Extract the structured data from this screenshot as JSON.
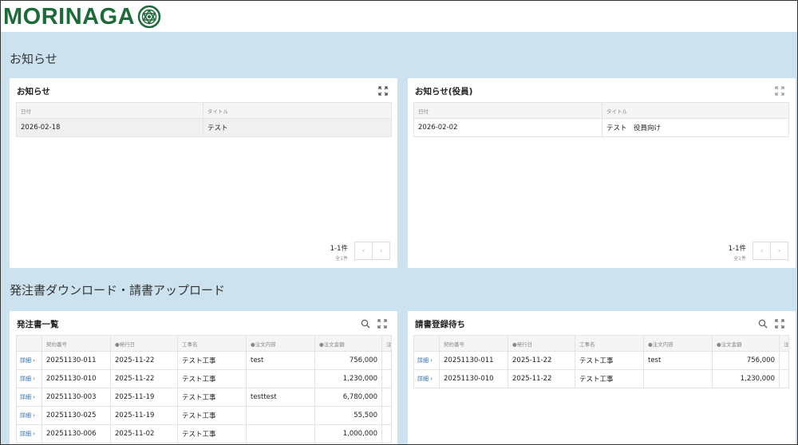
{
  "header": {
    "logo_text": "MORINAGA"
  },
  "sections": {
    "notices_title": "お知らせ",
    "orders_title": "発注書ダウンロード・請書アップロード"
  },
  "notices": {
    "title": "お知らせ",
    "columns": [
      "日付",
      "タイトル"
    ],
    "rows": [
      {
        "date": "2026-02-18",
        "title": "テスト"
      }
    ],
    "pager_count": "1-1件",
    "pager_total": "全1件"
  },
  "officer_notices": {
    "title": "お知らせ(役員)",
    "columns": [
      "日付",
      "タイトル"
    ],
    "rows": [
      {
        "date": "2026-02-02",
        "title": "テスト　役員向け"
      }
    ],
    "pager_count": "1-1件",
    "pager_total": "全1件"
  },
  "orders": {
    "title": "発注書一覧",
    "detail_label": "詳細",
    "columns": [
      "契約番号",
      "●発行日",
      "工事名",
      "●注文内容",
      "●注文金額",
      "注"
    ],
    "rows": [
      {
        "no": "20251130-011",
        "date": "2025-11-22",
        "name": "テスト工事",
        "content": "test",
        "amount": "756,000"
      },
      {
        "no": "20251130-010",
        "date": "2025-11-22",
        "name": "テスト工事",
        "content": "",
        "amount": "1,230,000"
      },
      {
        "no": "20251130-003",
        "date": "2025-11-19",
        "name": "テスト工事",
        "content": "testtest",
        "amount": "6,780,000"
      },
      {
        "no": "20251130-025",
        "date": "2025-11-19",
        "name": "テスト工事",
        "content": "",
        "amount": "55,500"
      },
      {
        "no": "20251130-006",
        "date": "2025-11-02",
        "name": "テスト工事",
        "content": "",
        "amount": "1,000,000"
      }
    ]
  },
  "acceptance": {
    "title": "請書登録待ち",
    "detail_label": "詳細",
    "columns": [
      "契約番号",
      "●発行日",
      "工事名",
      "●注文内容",
      "●注文金額",
      "注"
    ],
    "rows": [
      {
        "no": "20251130-011",
        "date": "2025-11-22",
        "name": "テスト工事",
        "content": "test",
        "amount": "756,000"
      },
      {
        "no": "20251130-010",
        "date": "2025-11-22",
        "name": "テスト工事",
        "content": "",
        "amount": "1,230,000"
      }
    ]
  },
  "colors": {
    "brand_green": "#1d6b3a",
    "page_bg": "#cde2ef",
    "link_blue": "#2a6db5"
  },
  "icons": {
    "expand": "expand-icon",
    "search": "search-icon",
    "prev": "chevron-left-icon",
    "next": "chevron-right-icon",
    "detail": "chevron-right-icon"
  }
}
